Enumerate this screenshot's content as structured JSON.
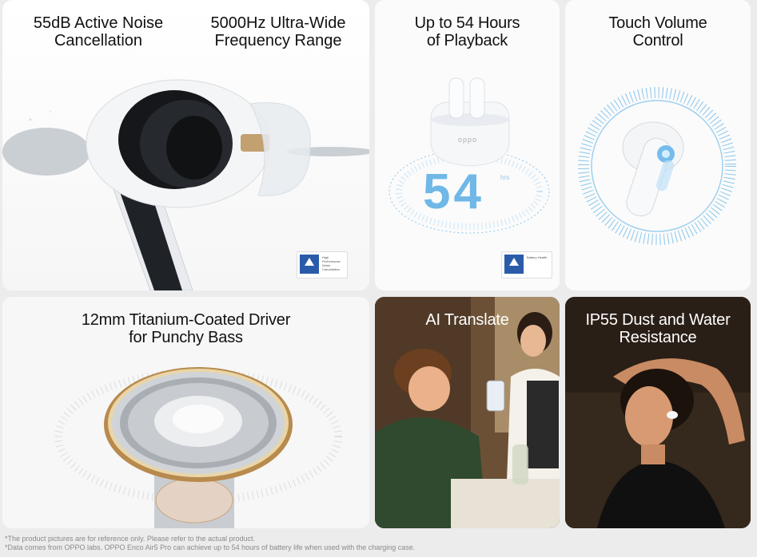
{
  "tiles": {
    "noise": {
      "title_left": "55dB Active Noise\nCancellation",
      "title_right": "5000Hz Ultra-Wide\nFrequency Range",
      "badge_text": "High Performance Noise Cancellation"
    },
    "playback": {
      "title": "Up to 54 Hours\nof Playback",
      "big_number": "54",
      "unit": "hrs",
      "case_logo": "oppo",
      "badge_text": "Battery Health"
    },
    "touch": {
      "title": "Touch Volume\nControl"
    },
    "driver": {
      "title": "12mm Titanium-Coated Driver\nfor Punchy Bass"
    },
    "translate": {
      "title": "AI Translate"
    },
    "ip55": {
      "title": "IP55 Dust and Water\nResistance"
    }
  },
  "footer": {
    "line1": "*The product pictures are for reference only. Please refer to the actual product.",
    "line2": "*Data comes from OPPO labs. OPPO Enco Air5 Pro can achieve up to 54 hours of battery life when used with the charging case."
  },
  "colors": {
    "accent_blue": "#4aa6e0",
    "gold": "#c89b55",
    "text": "#111111"
  }
}
